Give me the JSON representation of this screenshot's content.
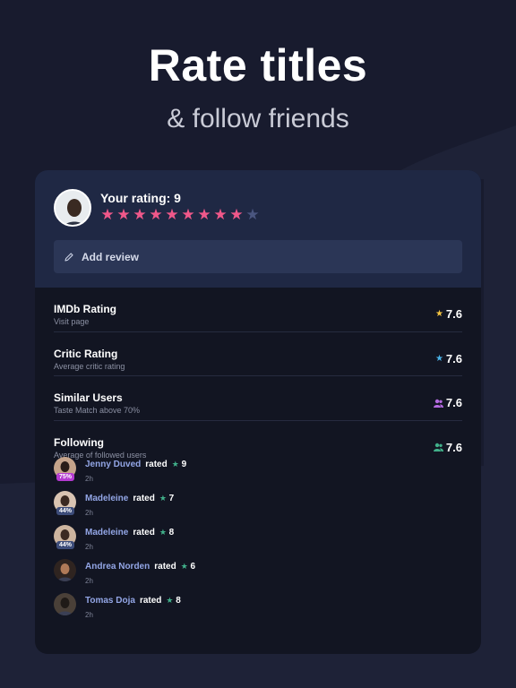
{
  "hero": {
    "title": "Rate titles",
    "subtitle": "& follow friends"
  },
  "colors": {
    "background": "#181b2e",
    "card": "#121522",
    "card_header": "#1f2844",
    "star_active": "#f0588a",
    "star_inactive": "#4a5680",
    "imdb_star": "#f5c542",
    "critic_star": "#4ab3e8",
    "similar_users": "#b46ae0",
    "following_users": "#41b08a"
  },
  "your_rating": {
    "label": "Your rating: 9",
    "value": 9,
    "max": 10
  },
  "add_review": {
    "label": "Add review",
    "icon": "pencil-icon"
  },
  "ratings": [
    {
      "title": "IMDb Rating",
      "subtitle": "Visit page",
      "value": "7.6",
      "icon": "star-icon"
    },
    {
      "title": "Critic Rating",
      "subtitle": "Average critic rating",
      "value": "7.6",
      "icon": "star-icon"
    },
    {
      "title": "Similar Users",
      "subtitle": "Taste Match above 70%",
      "value": "7.6",
      "icon": "users-icon"
    },
    {
      "title": "Following",
      "subtitle": "Average of followed users",
      "value": "7.6",
      "icon": "users-icon"
    }
  ],
  "feed": [
    {
      "name": "Jenny Duved",
      "rated": "rated",
      "score": "9",
      "time": "2h",
      "badge": "75%",
      "badge_color": "#b43ad0"
    },
    {
      "name": "Madeleine",
      "rated": "rated",
      "score": "7",
      "time": "2h",
      "badge": "44%",
      "badge_color": "#3d4d7a"
    },
    {
      "name": "Madeleine",
      "rated": "rated",
      "score": "8",
      "time": "2h",
      "badge": "44%",
      "badge_color": "#3d4d7a"
    },
    {
      "name": "Andrea Norden",
      "rated": "rated",
      "score": "6",
      "time": "2h",
      "badge": "",
      "badge_color": ""
    },
    {
      "name": "Tomas Doja",
      "rated": "rated",
      "score": "8",
      "time": "2h",
      "badge": "",
      "badge_color": ""
    }
  ]
}
